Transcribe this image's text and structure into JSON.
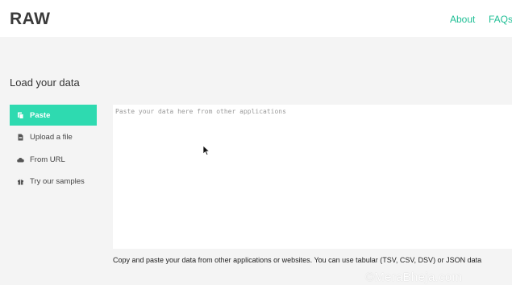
{
  "header": {
    "logo": "RAW",
    "nav": {
      "about": "About",
      "faqs": "FAQs"
    }
  },
  "main": {
    "title": "Load your data",
    "menu": [
      {
        "label": "Paste",
        "icon": "clipboard-icon",
        "active": true
      },
      {
        "label": "Upload a file",
        "icon": "file-icon",
        "active": false
      },
      {
        "label": "From URL",
        "icon": "cloud-icon",
        "active": false
      },
      {
        "label": "Try our samples",
        "icon": "gift-icon",
        "active": false
      }
    ],
    "textarea": {
      "placeholder": "Paste your data here from other applications",
      "value": ""
    },
    "help": "Copy and paste your data from other applications or websites. You can use tabular (TSV, CSV, DSV) or JSON data"
  },
  "watermark": "©MeraBheja.com",
  "colors": {
    "accent": "#2edab0",
    "link": "#1fbf95",
    "background": "#f4f4f4"
  }
}
